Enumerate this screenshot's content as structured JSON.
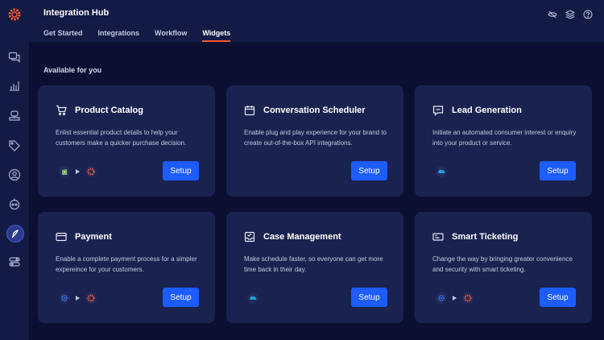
{
  "app": {
    "title": "Integration Hub"
  },
  "tabs": [
    {
      "label": "Get Started",
      "active": false
    },
    {
      "label": "Integrations",
      "active": false
    },
    {
      "label": "Workflow",
      "active": false
    },
    {
      "label": "Widgets",
      "active": true
    }
  ],
  "top_icons": [
    "eye-off-icon",
    "layers-icon",
    "help-icon"
  ],
  "sidebar": {
    "items": [
      "chat-icon",
      "bar-chart-icon",
      "bot-icon",
      "tag-icon",
      "user-circle-icon",
      "robot-icon",
      "widgets-icon",
      "toggle-icon"
    ],
    "active_index": 6
  },
  "section_title": "Available for you",
  "cards": [
    {
      "icon": "cart-icon",
      "title": "Product Catalog",
      "description": "Enlist essential product details to help your customers make a quicker purchase decision.",
      "flow": [
        "shopify-icon",
        "hub-logo-icon"
      ],
      "button": "Setup"
    },
    {
      "icon": "calendar-icon",
      "title": "Conversation Scheduler",
      "description": "Enable plug and play experience for your brand to create out-of-the-box API integrations.",
      "flow": [],
      "button": "Setup"
    },
    {
      "icon": "chat-square-icon",
      "title": "Lead Generation",
      "description": "Initiate an automated consumer interest or enquiry into your product or service.",
      "flow": [
        "salesforce-icon"
      ],
      "button": "Setup"
    },
    {
      "icon": "credit-card-icon",
      "title": "Payment",
      "description": "Enable a complete payment process for a simpler expereince for your customers.",
      "flow": [
        "gear-blue-icon",
        "hub-logo-icon"
      ],
      "button": "Setup"
    },
    {
      "icon": "inbox-check-icon",
      "title": "Case Management",
      "description": "Make schedule faster, so everyone can get more time back in their day.",
      "flow": [
        "salesforce-icon"
      ],
      "button": "Setup"
    },
    {
      "icon": "ticket-icon",
      "title": "Smart Ticketing",
      "description": "Change the way by bringing greater convenience and security with smart ticketing.",
      "flow": [
        "gear-blue-icon",
        "hub-logo-icon"
      ],
      "button": "Setup"
    }
  ],
  "colors": {
    "background": "#0b1033",
    "panel": "#131a44",
    "card": "#1a2250",
    "accent": "#f4592c",
    "button": "#1d5cff"
  }
}
